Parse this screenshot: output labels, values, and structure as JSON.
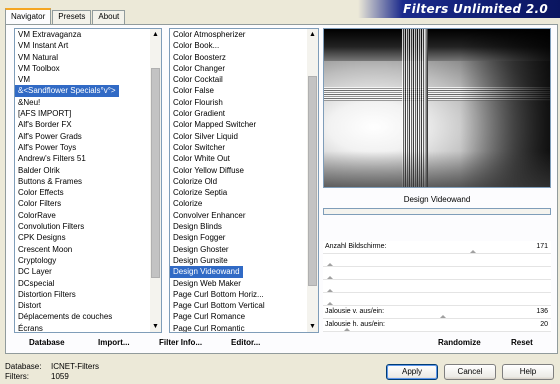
{
  "app": {
    "title": "Filters Unlimited 2.0",
    "accent_color": "#0a1560"
  },
  "tabs": [
    {
      "label": "Navigator",
      "active": true
    },
    {
      "label": "Presets",
      "active": false
    },
    {
      "label": "About",
      "active": false
    }
  ],
  "categories": {
    "items": [
      "VM Extravaganza",
      "VM Instant Art",
      "VM Natural",
      "VM Toolbox",
      "VM",
      "&<Sandflower Specials°v°>",
      "&Neu!",
      "[AFS IMPORT]",
      "Alf's Border FX",
      "Alf's Power Grads",
      "Alf's Power Toys",
      "Andrew's Filters 51",
      "Balder Olrik",
      "Buttons & Frames",
      "Color Effects",
      "Color Filters",
      "ColorRave",
      "Convolution Filters",
      "CPK Designs",
      "Crescent Moon",
      "Cryptology",
      "DC Layer",
      "DCspecial",
      "Distortion Filters",
      "Distort",
      "Déplacements de couches",
      "Écrans"
    ],
    "selected_index": 5,
    "scroll_fraction": 0.4
  },
  "filters": {
    "items": [
      "Color Atmospherizer",
      "Color Book...",
      "Color Boosterz",
      "Color Changer",
      "Color Cocktail",
      "Color False",
      "Color Flourish",
      "Color Gradient",
      "Color Mapped Switcher",
      "Color Silver Liquid",
      "Color Switcher",
      "Color White Out",
      "Color Yellow Diffuse",
      "Colorize Old",
      "Colorize Septia",
      "Colorize",
      "Convolver Enhancer",
      "Design Blinds",
      "Design Fogger",
      "Design Ghoster",
      "Design Gunsite",
      "Design Videowand",
      "Design Web Maker",
      "Page Curl Bottom Horiz...",
      "Page Curl Bottom Vertical",
      "Page Curl Romance",
      "Page Curl Romantic"
    ],
    "selected_index": 21,
    "scroll_fraction": 0.5
  },
  "preview": {
    "filter_name": "Design Videowand",
    "progress": 0
  },
  "sliders": [
    {
      "label": "Anzahl Bildschirme:",
      "value": "171",
      "level": 0.67
    },
    {
      "label": "",
      "value": "",
      "level": 0
    },
    {
      "label": "",
      "value": "",
      "level": 0
    },
    {
      "label": "",
      "value": "",
      "level": 0
    },
    {
      "label": "",
      "value": "",
      "level": 0
    },
    {
      "label": "Jalousie v. aus/ein:",
      "value": "136",
      "level": 0.53
    },
    {
      "label": "Jalousie h. aus/ein:",
      "value": "20",
      "level": 0.08
    }
  ],
  "panel_buttons": {
    "database": "Database",
    "import": "Import...",
    "filter_info": "Filter Info...",
    "editor": "Editor...",
    "randomize": "Randomize",
    "reset": "Reset"
  },
  "status": {
    "database_label": "Database:",
    "database_value": "ICNET-Filters",
    "filters_label": "Filters:",
    "filters_value": "1059"
  },
  "dialog_buttons": {
    "apply": "Apply",
    "cancel": "Cancel",
    "help": "Help"
  }
}
